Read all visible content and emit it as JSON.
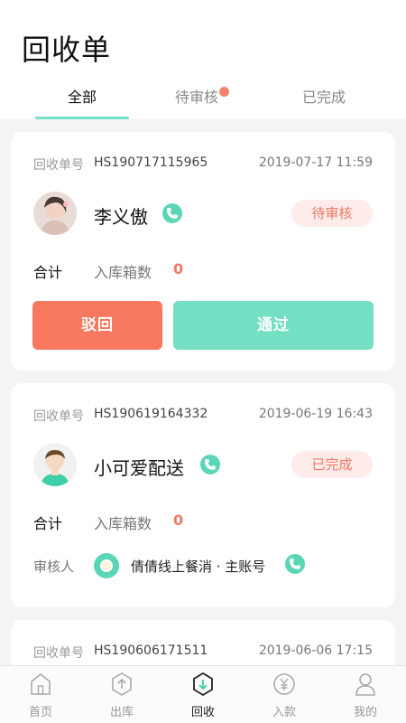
{
  "header": {
    "title": "回收单"
  },
  "tabs": [
    {
      "label": "全部",
      "active": true
    },
    {
      "label": "待审核",
      "has_dot": true
    },
    {
      "label": "已完成"
    }
  ],
  "colors": {
    "accent": "#74dfc2",
    "danger": "#f7785e",
    "badge_text": "#f07a66"
  },
  "orders": [
    {
      "order_label": "回收单号",
      "order_no": "HS190717115965",
      "time": "2019-07-17 11:59",
      "name": "李义傲",
      "status": "待审核",
      "total_label": "合计",
      "boxes_label": "入库箱数",
      "boxes_value": "0",
      "actions": {
        "reject": "驳回",
        "approve": "通过"
      }
    },
    {
      "order_label": "回收单号",
      "order_no": "HS190619164332",
      "time": "2019-06-19 16:43",
      "name": "小可爱配送",
      "status": "已完成",
      "total_label": "合计",
      "boxes_label": "入库箱数",
      "boxes_value": "0",
      "reviewer_label": "审核人",
      "reviewer_name": "倩倩线上餐消 · 主账号"
    },
    {
      "order_label": "回收单号",
      "order_no": "HS190606171511",
      "time": "2019-06-06 17:15"
    }
  ],
  "tabbar": [
    {
      "label": "首页",
      "icon": "home-icon"
    },
    {
      "label": "出库",
      "icon": "outbound-icon"
    },
    {
      "label": "回收",
      "icon": "recycle-icon",
      "active": true
    },
    {
      "label": "入款",
      "icon": "yen-icon"
    },
    {
      "label": "我的",
      "icon": "profile-icon"
    }
  ]
}
